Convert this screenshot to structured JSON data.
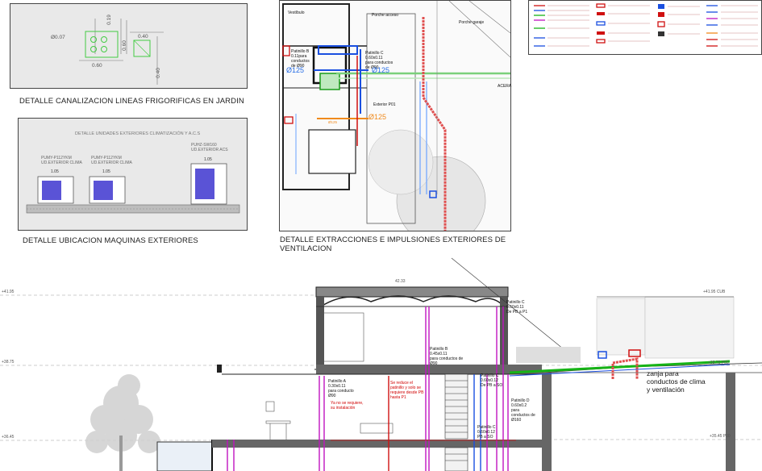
{
  "captions": {
    "jardin": "DETALLE CANALIZACION LINEAS FRIGORIFICAS EN JARDIN",
    "maquinas": "DETALLE UBICACION MAQUINAS EXTERIORES",
    "ventilacion_line1": "DETALLE EXTRACCIONES E IMPULSIONES EXTERIORES DE",
    "ventilacion_line2": "VENTILACION"
  },
  "jardin_detail": {
    "dim_pipe": "Ø0.07",
    "dim_w1": "0.60",
    "dim_h1": "0.60",
    "dim_top": "0.19",
    "dim_box": "0.40",
    "dim_low": "0.40"
  },
  "maquinas_detail": {
    "title": "DETALLE UNIDADES EXTERIORES CLIMATIZACIÓN Y A.C.S",
    "unit1_label": "PUMY-P112YKM\nUD.EXTERIOR CLIMA",
    "unit2_label": "PUMY-P112YKM\nUD.EXTERIOR CLIMA",
    "unit3_label": "PUHZ-SW160\nUD.EXTERIOR ACS",
    "unit1_w": "1.05",
    "unit2_w": "1.05",
    "unit3_w": "1.05"
  },
  "ventilacion_detail": {
    "room1": "Vestíbulo",
    "room2": "Porche acceso",
    "room3": "Porche garaje",
    "patinillo_c": "Patinillo C\n0.60x0.11\npara conductos\nde Ø90",
    "patinillo_b": "Patinillo B\n0.11para\nconductos\nde Ø90",
    "duct_a": "Ø125",
    "duct_b": "Ø125",
    "duct_c": "Ø125",
    "duct_d": "Ø125",
    "exterior": "Exterior P01",
    "acera": "ACERA"
  },
  "section": {
    "level_top": "+41.95",
    "level_mid": "+38.75",
    "level_low": "+36.45",
    "right_top": "+41.95 CUB",
    "right_mid": "+38.75 P00",
    "right_low": "+35.45 P00",
    "pat_a": "Patinillo A\n0.30x0.11\npara conducto\nØ90",
    "pat_a_note": "Ya no se requiere,\nsu instalación",
    "pat_red_note": "Se reduce el\npatinillo y solo se\nrequiere desde PB\nhasta P1",
    "pat_b": "Patinillo B\n0.45x0.11\npara conductos de\nØ90",
    "pat_c_top": "Patinillo C\n0.60x0.11\nDe PB a P1",
    "pat_c": "Patinillo C\n0.60x0.12\nDe PB a SO",
    "pat_d": "Patinillo D\n0.60x0.2\npara\nconductos de\nØ160",
    "pat_c_low": "Patinillo C\n0.60x0.12\nPB a SO",
    "zanja": "zanja para\nconductos de clima\ny ventilación",
    "top_dim": "42.33"
  },
  "legend": {
    "items": [
      "CONDUCTO DE IMPULSIÓN",
      "CONDUCTO DE RETORNO",
      "TUBERÍA",
      "REJILLA",
      "DIFUSOR",
      "EXTRACTOR",
      "FANCOIL",
      "UNIDAD EXTERIOR"
    ]
  },
  "colors": {
    "red": "#d01010",
    "blue": "#1a4fe0",
    "green": "#16b316",
    "magenta": "#c014c0",
    "orange": "#f08a1c"
  }
}
